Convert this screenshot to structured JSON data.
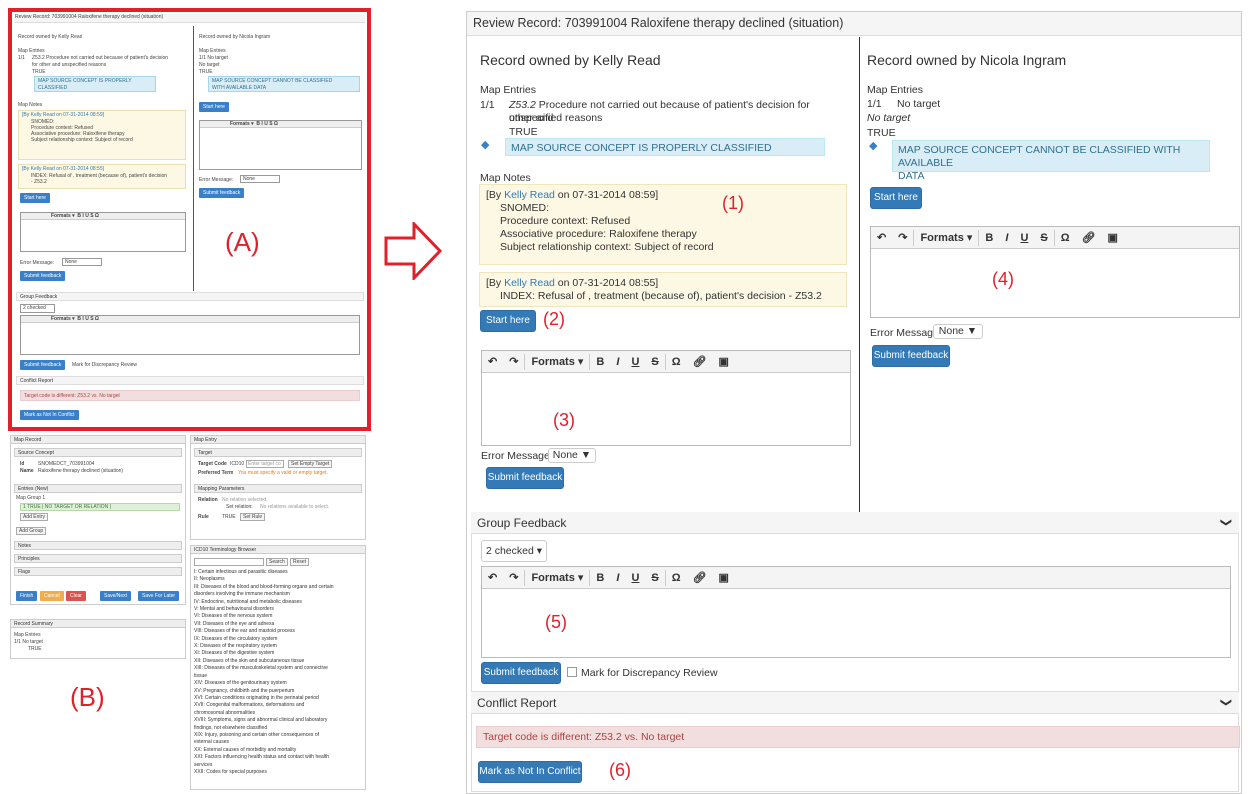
{
  "thumb_a": {
    "title": "Review Record: 703991004 Raloxifene therapy declined (situation)",
    "left_owner": "Record owned by Kelly Read",
    "right_owner": "Record owned by Nicola Ingram",
    "map_entries": "Map Entries",
    "left_entry_num": "1/1",
    "left_entry_text": "Z53.2 Procedure not carried out because of patient's decision",
    "left_entry_text2": "for other and unspecified reasons",
    "left_true": "TRUE",
    "left_info": "MAP SOURCE CONCEPT IS PROPERLY",
    "left_info2": "CLASSIFIED",
    "right_entry": "1/1 No target",
    "right_no_target": "No target",
    "right_true": "TRUE",
    "right_info": "MAP SOURCE CONCEPT CANNOT BE CLASSIFIED",
    "right_info2": "WITH AVAILABLE DATA",
    "map_notes": "Map Notes",
    "note1_head": "[By Kelly Read on 07-31-2014 08:59]",
    "note1_l1": "SNOMED:",
    "note1_l2": "Procedure context: Refused",
    "note1_l3": "Associative procedure: Raloxifene therapy",
    "note1_l4": "Subject relationship context: Subject of record",
    "note2_head": "[By Kelly Read on 07-31-2014 08:55]",
    "note2_l1": "INDEX: Refusal of , treatment (because of), patient's decision",
    "note2_l2": "- Z53.2",
    "start_here": "Start here",
    "formats": "Formats",
    "error_message": "Error Message:",
    "none": "None",
    "submit_feedback": "Submit feedback",
    "group_feedback": "Group Feedback",
    "checked": "2 checked",
    "mark_discrepancy": "Mark for Discrepancy Review",
    "conflict_report": "Conflict Report",
    "conflict_text": "Target code is different: Z53.2 vs. No target",
    "mark_not_conflict": "Mark as Not In Conflict",
    "label": "(A)"
  },
  "thumb_b": {
    "map_record": "Map Record",
    "source_concept": "Source Concept",
    "id_label": "Id",
    "id_value": "SNOMEDCT_703991004",
    "name_label": "Name",
    "name_value": "Raloxifene therapy declined (situation)",
    "entries_new": "Entries (New)",
    "map_group": "Map Group 1",
    "group_entry": "1 TRUE | NO TARGET OR RELATION |",
    "add_entry": "Add Entry",
    "add_group": "Add Group",
    "notes": "Notes",
    "principles": "Principles",
    "flags": "Flags",
    "finish": "Finish",
    "cancel": "Cancel",
    "clear": "Clear",
    "save_next": "Save/Next",
    "save_later": "Save For Later",
    "record_summary": "Record Summary",
    "rs_map_entries": "Map Entries",
    "rs_entry": "1/1 No target",
    "rs_true": "TRUE",
    "map_entry": "Map Entry",
    "target": "Target",
    "target_code": "Target Code",
    "icd10": "ICD10",
    "enter_target": "Enter target co",
    "set_empty": "Set Empty Target",
    "preferred_term": "Preferred Term",
    "pref_warning": "You must specify a valid or empty target.",
    "mapping_params": "Mapping Parameters",
    "relation": "Relation",
    "no_relation": "No relation selected.",
    "set_relation": "Set relation:",
    "no_relations_avail": "No relations available to select.",
    "rule": "Rule",
    "rule_true": "TRUE",
    "set_rule": "Set Rule",
    "browser_title": "ICD10 Terminology Browser",
    "search": "Search",
    "reset": "Reset",
    "chapters": [
      "I: Certain infectious and parasitic diseases",
      "II: Neoplasms",
      "III: Diseases of the blood and blood-forming organs and certain",
      "disorders involving the immune mechanism",
      "IV: Endocrine, nutritional and metabolic diseases",
      "V: Mental and behavioural disorders",
      "VI: Diseases of the nervous system",
      "VII: Diseases of the eye and adnexa",
      "VIII: Diseases of the ear and mastoid process",
      "IX: Diseases of the circulatory system",
      "X: Diseases of the respiratory system",
      "XI: Diseases of the digestive system",
      "XII: Diseases of the skin and subcutaneous tissue",
      "XIII: Diseases of the musculoskeletal system and connective",
      "tissue",
      "XIV: Diseases of the genitourinary system",
      "XV: Pregnancy, childbirth and the puerperium",
      "XVI: Certain conditions originating in the perinatal period",
      "XVII: Congenital malformations, deformations and",
      "chromosomal abnormalities",
      "XVIII: Symptoms, signs and abnormal clinical and laboratory",
      "findings, not elsewhere classified",
      "XIX: Injury, poisoning and certain other consequences of",
      "external causes",
      "XX: External causes of morbidity and mortality",
      "XXI: Factors influencing health status and contact with health",
      "services",
      "XXII: Codes for special purposes"
    ],
    "label": "(B)"
  },
  "main": {
    "title": "Review Record: 703991004 Raloxifene therapy declined (situation)",
    "left": {
      "owner": "Record owned by Kelly Read",
      "map_entries": "Map Entries",
      "entry_num": "1/1",
      "entry_code": "Z53.2",
      "entry_desc1": "Procedure not carried out because of patient's decision for other and",
      "entry_desc2": "unspecified reasons",
      "true": "TRUE",
      "info": "MAP SOURCE CONCEPT IS PROPERLY CLASSIFIED",
      "map_notes": "Map Notes",
      "note1_by": "[By ",
      "note1_author": "Kelly Read",
      "note1_date": " on 07-31-2014 08:59]",
      "note1_l1": "SNOMED:",
      "note1_l2": "Procedure context: Refused",
      "note1_l3": "Associative procedure: Raloxifene therapy",
      "note1_l4": "Subject relationship context:  Subject of record",
      "note2_by": "[By ",
      "note2_author": "Kelly Read",
      "note2_date": " on 07-31-2014 08:55]",
      "note2_l1": "INDEX:  Refusal of , treatment (because of), patient's decision - Z53.2",
      "start_here": "Start here",
      "formats": "Formats",
      "error_message": "Error Message:",
      "error_value": "None",
      "submit_feedback": "Submit feedback"
    },
    "right": {
      "owner": "Record owned by Nicola Ingram",
      "map_entries": "Map Entries",
      "entry_num": "1/1",
      "entry_text": "No target",
      "no_target": "No target",
      "true": "TRUE",
      "info1": "MAP SOURCE CONCEPT CANNOT BE CLASSIFIED WITH AVAILABLE",
      "info2": "DATA",
      "start_here": "Start here",
      "formats": "Formats",
      "error_message": "Error Message:",
      "error_value": "None",
      "submit_feedback": "Submit feedback"
    },
    "group_feedback": {
      "title": "Group Feedback",
      "checked": "2 checked",
      "formats": "Formats",
      "submit_feedback": "Submit feedback",
      "mark_discrepancy": "Mark for Discrepancy Review"
    },
    "conflict_report": {
      "title": "Conflict Report",
      "text": "Target code is different: Z53.2 vs. No target",
      "mark_not_conflict": "Mark as Not In Conflict"
    },
    "annotations": [
      "(1)",
      "(2)",
      "(3)",
      "(4)",
      "(5)",
      "(6)"
    ]
  },
  "colors": {
    "highlight_red": "#e0202a",
    "primary_blue": "#337ab7",
    "note_bg": "#fcf8e3",
    "info_bg": "#d9edf7",
    "danger_bg": "#f2dede"
  },
  "icons": [
    "arrow-right-icon",
    "tag-icon",
    "chevron-down-icon",
    "undo-icon",
    "redo-icon",
    "bold-icon",
    "italic-icon",
    "underline-icon",
    "strikethrough-icon",
    "omega-icon",
    "link-icon",
    "image-icon",
    "info-icon",
    "close-icon"
  ]
}
